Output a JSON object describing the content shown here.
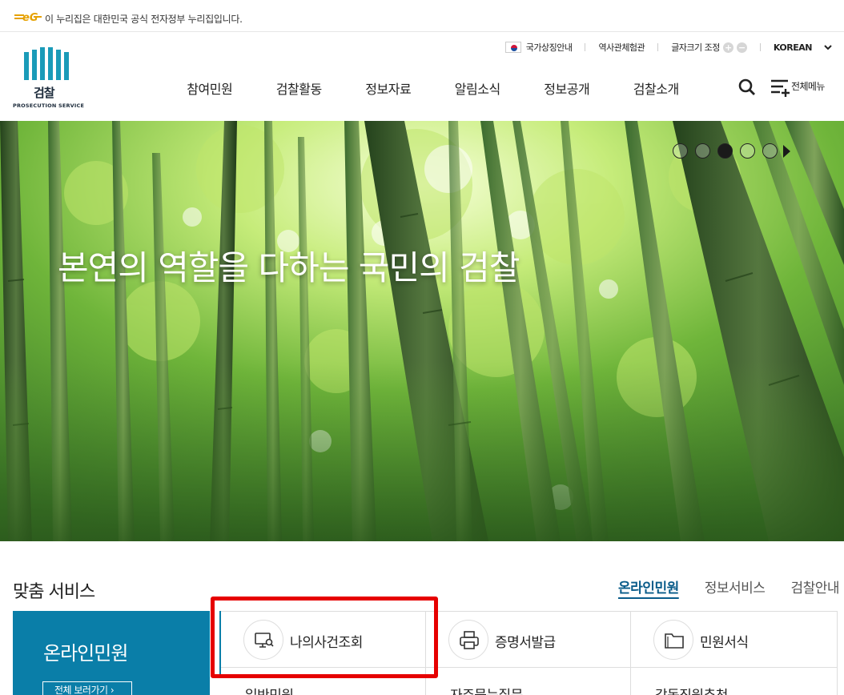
{
  "gov_banner": {
    "text": "이 누리집은 대한민국 공식 전자정부 누리집입니다."
  },
  "logo": {
    "kr": "검찰",
    "en": "PROSECUTION SERVICE"
  },
  "util": {
    "national_symbol": "국가상징안내",
    "history_hall": "역사관체험관",
    "font_size": "글자크기 조정",
    "language": "KOREAN"
  },
  "gnb": [
    "참여민원",
    "검찰활동",
    "정보자료",
    "알림소식",
    "정보공개",
    "검찰소개"
  ],
  "all_menu_label": "전체메뉴",
  "hero": {
    "headline": "본연의 역할을 다하는 국민의 검찰",
    "slide_count": 5,
    "active_slide": 3
  },
  "services": {
    "title": "맞춤 서비스",
    "tabs": [
      "온라인민원",
      "정보서비스",
      "검찰안내"
    ],
    "active_tab": 0,
    "panel_title": "온라인민원",
    "panel_button": "전체 보러가기",
    "row1": [
      {
        "label": "나의사건조회",
        "icon": "monitor-search-icon"
      },
      {
        "label": "증명서발급",
        "icon": "printer-icon"
      },
      {
        "label": "민원서식",
        "icon": "folder-icon"
      }
    ],
    "row2": [
      "일반민원",
      "자주묻는질문",
      "감동직원추천"
    ]
  },
  "colors": {
    "accent": "#0a7ea8",
    "highlight": "#e60000",
    "active_tab": "#0a5c8a"
  }
}
